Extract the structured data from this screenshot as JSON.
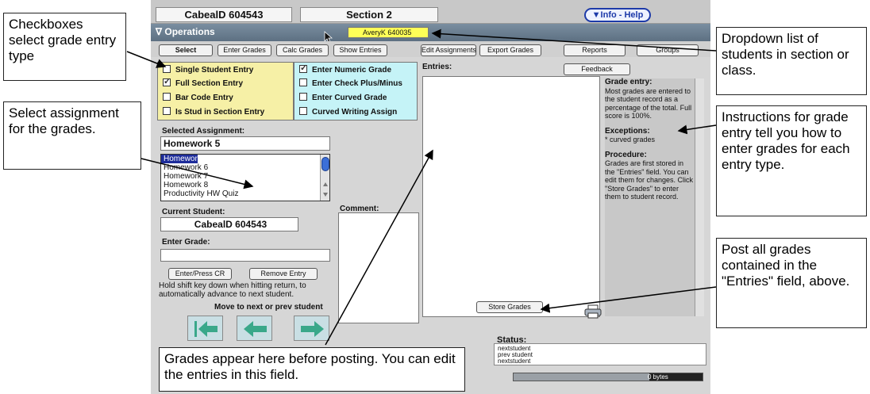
{
  "header": {
    "student_id_title": "CabealD 604543",
    "section_title": "Section 2",
    "info_help_label": "▼Info - Help"
  },
  "operations": {
    "label": "∇ Operations",
    "student_dropdown_value": "AveryK 640035"
  },
  "toolbar": {
    "select": "Select",
    "enter_grades": "Enter Grades",
    "calc_grades": "Calc Grades",
    "show_entries": "Show Entries",
    "edit_assignments": "Edit Assignments",
    "export_grades": "Export Grades",
    "reports": "Reports",
    "groups": "Groups",
    "feedback": "Feedback"
  },
  "entry_type_options": [
    {
      "label": "Single Student Entry",
      "checked": false
    },
    {
      "label": "Full Section Entry",
      "checked": true
    },
    {
      "label": "Bar Code Entry",
      "checked": false
    },
    {
      "label": "Is Stud in Section Entry",
      "checked": false
    }
  ],
  "grade_type_options": [
    {
      "label": "Enter Numeric Grade",
      "checked": true
    },
    {
      "label": "Enter Check Plus/Minus",
      "checked": false
    },
    {
      "label": "Enter Curved Grade",
      "checked": false
    },
    {
      "label": "Curved Writing Assign",
      "checked": false
    }
  ],
  "assignment": {
    "selected_label": "Selected Assignment:",
    "selected_value": "Homework 5",
    "list": [
      "Homework 5",
      "Homework 6",
      "Homework 7",
      "Homework 8",
      "Productivity HW Quiz"
    ]
  },
  "student": {
    "current_label": "Current Student:",
    "current_value": "CabealD 604543",
    "enter_grade_label": "Enter Grade:",
    "enter_grade_value": "",
    "enter_btn": "Enter/Press CR",
    "remove_btn": "Remove Entry",
    "help_text": "Hold shift key down when hitting return, to automatically advance to next student.",
    "move_label": "Move to next or prev student"
  },
  "comment_label": "Comment:",
  "entries_label": "Entries:",
  "instructions": {
    "heading1": "Grade entry:",
    "text1": "Most grades are entered to the student record as a percentage of the total. Full score is 100%.",
    "heading2": "Exceptions:",
    "text2": "* curved grades",
    "heading3": "Procedure:",
    "text3": "Grades are first stored in the \"Entries\" field. You can edit them for changes. Click \"Store Grades\" to enter them to student record."
  },
  "store_grades": "Store Grades",
  "status": {
    "label": "Status:",
    "lines": [
      "nextstudent",
      "prev student",
      "nextstudent"
    ]
  },
  "progress": {
    "label": "0 bytes",
    "fraction": 0.72
  },
  "callouts": {
    "checkboxes": "Checkboxes select grade entry type",
    "select_assignment": "Select assignment for the grades.",
    "dropdown": "Dropdown list of students in section or class.",
    "instructions": "Instructions for grade entry tell you how to enter grades for each entry type.",
    "post_grades": "Post all grades contained in the \"Entries\" field, above.",
    "grades_appear": "Grades appear here before posting. You can edit the entries in this field."
  },
  "colors": {
    "yellow_panel": "#f6f0a6",
    "cyan_panel": "#c5f3f7",
    "ops_bar": "#6a7e90",
    "nav_arrow": "#3aa88a"
  }
}
